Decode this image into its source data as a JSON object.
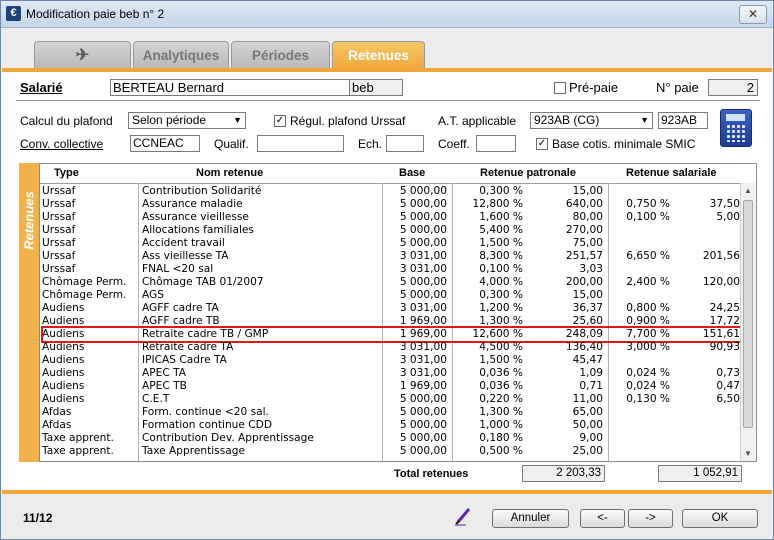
{
  "window": {
    "title": "Modification paie beb n° 2",
    "close": "✕",
    "app_icon": "€"
  },
  "tabs": [
    {
      "label": "",
      "icon": "tool-icon",
      "glyph": "✈"
    },
    {
      "label": "Analytiques"
    },
    {
      "label": "Périodes"
    },
    {
      "label": "Retenues",
      "active": true
    }
  ],
  "header": {
    "salarie_label": "Salarié",
    "salarie_name": "BERTEAU Bernard",
    "salarie_code": "beb",
    "prepaie_label": "Pré-paie",
    "prepaie_checked": false,
    "no_paie_label": "N° paie",
    "no_paie_value": "2"
  },
  "form": {
    "calcul_plafond_label": "Calcul du plafond",
    "calcul_plafond_value": "Selon période",
    "regul_label": "Régul. plafond Urssaf",
    "regul_checked": "✓",
    "at_label": "A.T. applicable",
    "at_value": "923AB (CG)",
    "at_code": "923AB",
    "conv_label": "Conv. collective",
    "conv_value": "CCNEAC",
    "qualif_label": "Qualif.",
    "ech_label": "Ech.",
    "coeff_label": "Coeff.",
    "base_label": "Base cotis. minimale SMIC",
    "base_checked": "✓"
  },
  "grid": {
    "side_label": "Retenues",
    "headers": {
      "type": "Type",
      "nom": "Nom retenue",
      "base": "Base",
      "patronale": "Retenue patronale",
      "salariale": "Retenue salariale"
    },
    "rows": [
      {
        "type": "Urssaf",
        "nom": "Contribution Solidarité",
        "base": "5 000,00",
        "tp": "0,300 %",
        "mp": "15,00",
        "ts": "",
        "ms": ""
      },
      {
        "type": "Urssaf",
        "nom": "Assurance maladie",
        "base": "5 000,00",
        "tp": "12,800 %",
        "mp": "640,00",
        "ts": "0,750 %",
        "ms": "37,50"
      },
      {
        "type": "Urssaf",
        "nom": "Assurance vieillesse",
        "base": "5 000,00",
        "tp": "1,600 %",
        "mp": "80,00",
        "ts": "0,100 %",
        "ms": "5,00"
      },
      {
        "type": "Urssaf",
        "nom": "Allocations familiales",
        "base": "5 000,00",
        "tp": "5,400 %",
        "mp": "270,00",
        "ts": "",
        "ms": ""
      },
      {
        "type": "Urssaf",
        "nom": "Accident travail",
        "base": "5 000,00",
        "tp": "1,500 %",
        "mp": "75,00",
        "ts": "",
        "ms": ""
      },
      {
        "type": "Urssaf",
        "nom": "Ass vieillesse TA",
        "base": "3 031,00",
        "tp": "8,300 %",
        "mp": "251,57",
        "ts": "6,650 %",
        "ms": "201,56"
      },
      {
        "type": "Urssaf",
        "nom": "FNAL <20 sal",
        "base": "3 031,00",
        "tp": "0,100 %",
        "mp": "3,03",
        "ts": "",
        "ms": ""
      },
      {
        "type": "Chômage Perm.",
        "nom": "Chômage TAB 01/2007",
        "base": "5 000,00",
        "tp": "4,000 %",
        "mp": "200,00",
        "ts": "2,400 %",
        "ms": "120,00"
      },
      {
        "type": "Chômage Perm.",
        "nom": "AGS",
        "base": "5 000,00",
        "tp": "0,300 %",
        "mp": "15,00",
        "ts": "",
        "ms": ""
      },
      {
        "type": "Audiens",
        "nom": "AGFF cadre TA",
        "base": "3 031,00",
        "tp": "1,200 %",
        "mp": "36,37",
        "ts": "0,800 %",
        "ms": "24,25"
      },
      {
        "type": "Audiens",
        "nom": "AGFF cadre TB",
        "base": "1 969,00",
        "tp": "1,300 %",
        "mp": "25,60",
        "ts": "0,900 %",
        "ms": "17,72"
      },
      {
        "type": "Audiens",
        "nom": "Retraite cadre TB / GMP",
        "base": "1 969,00",
        "tp": "12,600 %",
        "mp": "248,09",
        "ts": "7,700 %",
        "ms": "151,61",
        "selected": true
      },
      {
        "type": "Audiens",
        "nom": "Retraite cadre TA",
        "base": "3 031,00",
        "tp": "4,500 %",
        "mp": "136,40",
        "ts": "3,000 %",
        "ms": "90,93"
      },
      {
        "type": "Audiens",
        "nom": "IPICAS Cadre TA",
        "base": "3 031,00",
        "tp": "1,500 %",
        "mp": "45,47",
        "ts": "",
        "ms": ""
      },
      {
        "type": "Audiens",
        "nom": "APEC TA",
        "base": "3 031,00",
        "tp": "0,036 %",
        "mp": "1,09",
        "ts": "0,024 %",
        "ms": "0,73"
      },
      {
        "type": "Audiens",
        "nom": "APEC TB",
        "base": "1 969,00",
        "tp": "0,036 %",
        "mp": "0,71",
        "ts": "0,024 %",
        "ms": "0,47"
      },
      {
        "type": "Audiens",
        "nom": "C.E.T",
        "base": "5 000,00",
        "tp": "0,220 %",
        "mp": "11,00",
        "ts": "0,130 %",
        "ms": "6,50"
      },
      {
        "type": "Afdas",
        "nom": "Form. continue <20 sal.",
        "base": "5 000,00",
        "tp": "1,300 %",
        "mp": "65,00",
        "ts": "",
        "ms": ""
      },
      {
        "type": "Afdas",
        "nom": "Formation continue CDD",
        "base": "5 000,00",
        "tp": "1,000 %",
        "mp": "50,00",
        "ts": "",
        "ms": ""
      },
      {
        "type": "Taxe apprent.",
        "nom": "Contribution Dev. Apprentissage",
        "base": "5 000,00",
        "tp": "0,180 %",
        "mp": "9,00",
        "ts": "",
        "ms": ""
      },
      {
        "type": "Taxe apprent.",
        "nom": "Taxe Apprentissage",
        "base": "5 000,00",
        "tp": "0,500 %",
        "mp": "25,00",
        "ts": "",
        "ms": ""
      }
    ],
    "total_label": "Total retenues",
    "total_patronale": "2 203,33",
    "total_salariale": "1 052,91"
  },
  "footer": {
    "page": "11/12",
    "annuler": "Annuler",
    "prev": "<-",
    "next": "->",
    "ok": "OK"
  }
}
